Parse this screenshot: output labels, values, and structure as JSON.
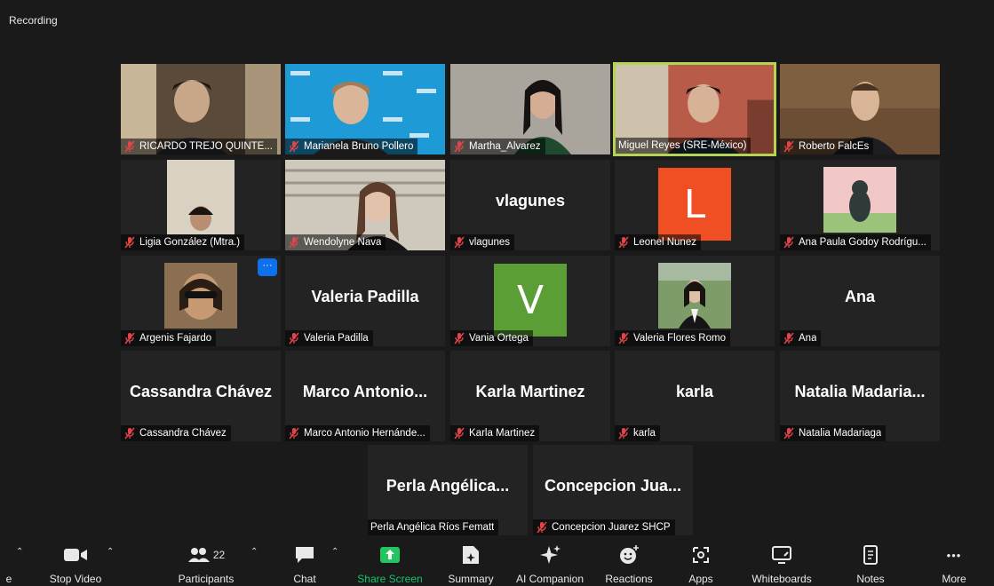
{
  "recording_label": "Recording",
  "colors": {
    "active_border": "#b4d455",
    "share_green": "#22c55e",
    "mic_muted": "#e0454a",
    "avatar_orange": "#f04e23",
    "avatar_green": "#5a9e35",
    "menu_blue": "#0e71eb"
  },
  "tiles": [
    {
      "label": "RICARDO TREJO QUINTE...",
      "muted": true
    },
    {
      "label": "Marianela Bruno Pollero",
      "muted": true
    },
    {
      "label": "Martha_Alvarez",
      "muted": true
    },
    {
      "label": "Miguel Reyes (SRE-México)",
      "muted": false,
      "active": true
    },
    {
      "label": "Roberto FalcEs",
      "muted": true
    },
    {
      "label": "Ligia González (Mtra.)",
      "muted": true
    },
    {
      "label": "Wendolyne Nava",
      "muted": true
    },
    {
      "label": "vlagunes",
      "big": "vlagunes",
      "muted": true
    },
    {
      "label": "Leonel Nunez",
      "avatar": "L",
      "muted": true
    },
    {
      "label": "Ana Paula Godoy Rodrígu...",
      "muted": true
    },
    {
      "label": "Argenis Fajardo",
      "muted": true,
      "menu": "···"
    },
    {
      "label": "Valeria Padilla",
      "big": "Valeria Padilla",
      "muted": true
    },
    {
      "label": "Vania Ortega",
      "avatar": "V",
      "muted": true
    },
    {
      "label": "Valeria Flores Romo",
      "muted": true
    },
    {
      "label": "Ana",
      "big": "Ana",
      "muted": true
    },
    {
      "label": "Cassandra Chávez",
      "big": "Cassandra Chávez",
      "muted": true
    },
    {
      "label": "Marco Antonio Hernánde...",
      "big": "Marco Antonio...",
      "muted": true
    },
    {
      "label": "Karla Martinez",
      "big": "Karla Martinez",
      "muted": true
    },
    {
      "label": "karla",
      "big": "karla",
      "muted": true
    },
    {
      "label": "Natalia Madariaga",
      "big": "Natalia Madaria...",
      "muted": true
    },
    {
      "label": "Perla Angélica Ríos Fematt",
      "big": "Perla Angélica...",
      "muted": false
    },
    {
      "label": "Concepcion Juarez SHCP",
      "big": "Concepcion Jua...",
      "muted": true
    }
  ],
  "toolbar": {
    "audio_label": "e",
    "stop_video": "Stop Video",
    "participants": "Participants",
    "participants_count": "22",
    "chat": "Chat",
    "share_screen": "Share Screen",
    "summary": "Summary",
    "ai_companion": "AI Companion",
    "reactions": "Reactions",
    "apps": "Apps",
    "whiteboards": "Whiteboards",
    "notes": "Notes",
    "more": "More",
    "more_dots": "•••"
  }
}
